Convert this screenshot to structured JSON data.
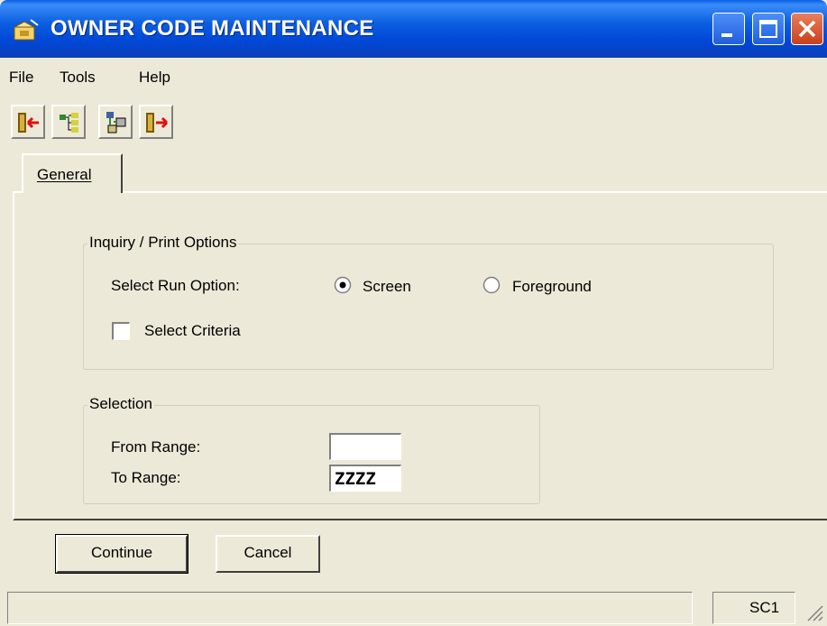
{
  "window": {
    "title": "OWNER CODE MAINTENANCE",
    "controls": {
      "minimize": "minimize-icon",
      "maximize": "maximize-icon",
      "close": "close-icon"
    }
  },
  "menu": [
    "File",
    "Tools",
    "Help"
  ],
  "toolbar": {
    "buttons": [
      "exit-icon",
      "tree-icon",
      "workstation-icon",
      "exit-forward-icon"
    ]
  },
  "tabs": [
    {
      "label": "General",
      "active": true
    }
  ],
  "inquiry_group": {
    "title": "Inquiry / Print Options",
    "run_option_label": "Select Run Option:",
    "options": [
      {
        "label": "Screen",
        "selected": true
      },
      {
        "label": "Foreground",
        "selected": false
      }
    ],
    "select_criteria": {
      "label": "Select Criteria",
      "checked": false
    }
  },
  "selection_group": {
    "title": "Selection",
    "from_label": "From Range:",
    "from_value": "",
    "to_label": "To Range:",
    "to_value": "ZZZZ"
  },
  "buttons": {
    "continue": "Continue",
    "cancel": "Cancel"
  },
  "status": {
    "pane1": "",
    "pane2": "SC1"
  },
  "colors": {
    "titlebar": "#0a5fe6",
    "face": "#ece9d8",
    "close": "#c8401b"
  }
}
